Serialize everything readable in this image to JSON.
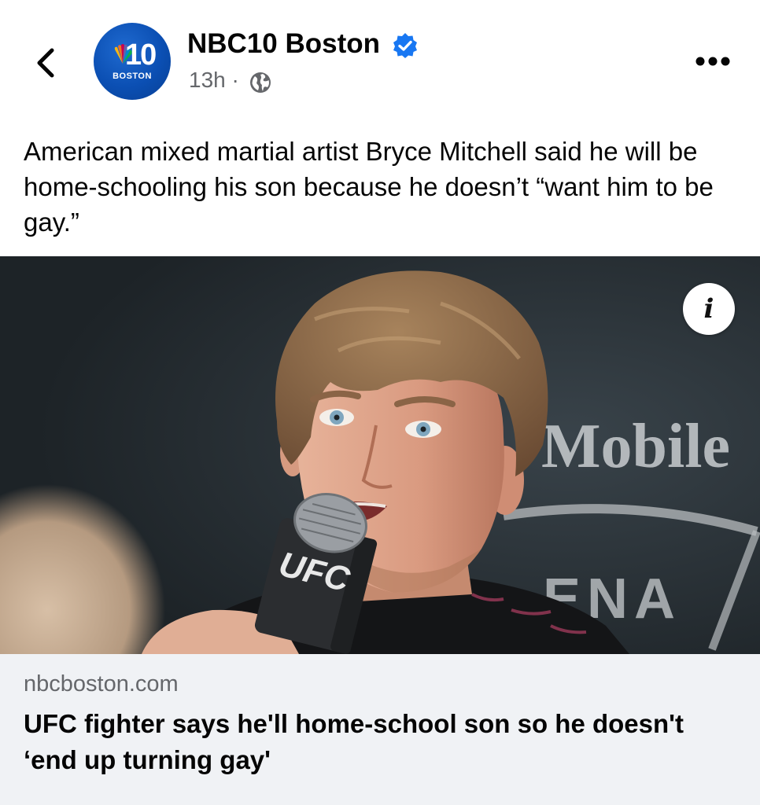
{
  "header": {
    "back_icon": "chevron-left-icon",
    "page_name": "NBC10 Boston",
    "verified_icon": "verified-badge-icon",
    "timestamp": "13h ·",
    "audience_icon": "globe-icon",
    "more_icon": "more-horizontal-icon",
    "avatar": {
      "number": "10",
      "city": "BOSTON",
      "brand_color": "#0b4fb3"
    }
  },
  "post": {
    "caption": "American mixed martial artist Bryce Mitchell said he will be home-schooling his son because he doesn’t “want him to be gay.”"
  },
  "photo": {
    "info_label": "i",
    "background_sign_1": "Mobile",
    "background_sign_2": "ENA",
    "mic_flag": "UFC"
  },
  "link_preview": {
    "domain": "nbcboston.com",
    "headline": "UFC fighter says he'll home-school son so he doesn't ‘end up turning gay'"
  },
  "colors": {
    "accent_blue": "#1877f2",
    "meta_gray": "#65676b",
    "card_bg": "#f0f2f5"
  }
}
